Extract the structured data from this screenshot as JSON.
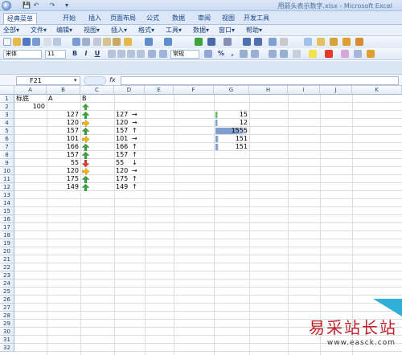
{
  "window": {
    "title": "用箭头表示数字.xlsx - Microsoft Excel",
    "quick_access": [
      "save",
      "undo",
      "redo",
      "customize"
    ]
  },
  "ribbon_tabs": [
    "经典菜单",
    "开始",
    "插入",
    "页面布局",
    "公式",
    "数据",
    "审阅",
    "视图",
    "开发工具"
  ],
  "menu": [
    "全部▾",
    "文件▾",
    "编辑▾",
    "视图▾",
    "插入▾",
    "格式▾",
    "工具▾",
    "数据▾",
    "窗口▾",
    "帮助▾"
  ],
  "toolbar": {
    "font_name": "宋体",
    "font_size": "11",
    "bold": "B",
    "italic": "I",
    "underline": "U",
    "number_format": "常规",
    "percent": "%",
    "comma": ","
  },
  "formula_bar": {
    "name_box": "F21",
    "fx": "fx",
    "content": ""
  },
  "columns": [
    "A",
    "B",
    "C",
    "D",
    "E",
    "F",
    "G",
    "H",
    "I",
    "J",
    "K"
  ],
  "row_numbers": [
    "1",
    "2",
    "3",
    "4",
    "5",
    "6",
    "7",
    "8",
    "9",
    "10",
    "11",
    "12",
    "13",
    "14",
    "15",
    "16",
    "17",
    "18",
    "19",
    "20",
    "21",
    "22",
    "23",
    "24",
    "25",
    "26",
    "27",
    "28",
    "29",
    "30",
    "31",
    "32"
  ],
  "cells": {
    "A1": "标底",
    "A2": "A",
    "B1": "B",
    "A2val": "100",
    "b_values": [
      "127",
      "120",
      "157",
      "101",
      "166",
      "157",
      "55",
      "120",
      "175",
      "149"
    ],
    "b_icons": [
      "up",
      "side",
      "up",
      "side",
      "up",
      "up",
      "down",
      "side",
      "up",
      "up"
    ],
    "d_values": [
      "127",
      "120",
      "157",
      "101",
      "166",
      "157",
      "55",
      "120",
      "175",
      "149"
    ],
    "d_arrows": [
      "→",
      "→",
      "↑",
      "→",
      "↑",
      "↑",
      "↓",
      "→",
      "↑",
      "↑"
    ],
    "g_values": [
      "15",
      "12",
      "1555",
      "151",
      "151"
    ],
    "g_bar_fraction": [
      0.01,
      0.008,
      1.0,
      0.097,
      0.097
    ]
  },
  "colors": {
    "arrow_up": "#3aa43a",
    "arrow_side": "#f5b800",
    "arrow_down": "#e23a2a",
    "databar_green": "#5cbf5c",
    "databar_blue": "#7f9fd0"
  },
  "watermark": {
    "brand": "易采站长站",
    "url": "www.easck.com"
  }
}
